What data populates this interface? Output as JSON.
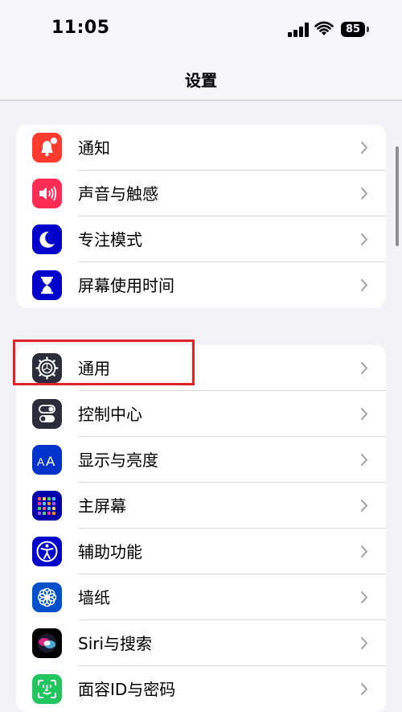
{
  "status_bar": {
    "time": "11:05",
    "battery": "85",
    "icons": [
      "signal-icon",
      "wifi-icon",
      "battery-icon"
    ]
  },
  "nav": {
    "title": "设置"
  },
  "groups": [
    {
      "items": [
        {
          "label": "通知",
          "icon": "bell-icon",
          "color": "#ff3b30"
        },
        {
          "label": "声音与触感",
          "icon": "speaker-icon",
          "color": "#ff2d55"
        },
        {
          "label": "专注模式",
          "icon": "moon-icon",
          "color": "#0000cc"
        },
        {
          "label": "屏幕使用时间",
          "icon": "hourglass-icon",
          "color": "#0000cc"
        }
      ]
    },
    {
      "items": [
        {
          "label": "通用",
          "icon": "gear-icon",
          "color": "#2c2c3a"
        },
        {
          "label": "控制中心",
          "icon": "toggles-icon",
          "color": "#2c2c3a"
        },
        {
          "label": "显示与亮度",
          "icon": "text-size-icon",
          "color": "#0033cc"
        },
        {
          "label": "主屏幕",
          "icon": "app-grid-icon",
          "color": "#0000aa"
        },
        {
          "label": "辅助功能",
          "icon": "accessibility-icon",
          "color": "#0000cc"
        },
        {
          "label": "墙纸",
          "icon": "flower-icon",
          "color": "#0050cc"
        },
        {
          "label": "Siri与搜索",
          "icon": "siri-icon",
          "color": "#000000"
        },
        {
          "label": "面容ID与密码",
          "icon": "face-id-icon",
          "color": "#22c55e"
        }
      ]
    }
  ],
  "highlight": {
    "target": "通用",
    "color": "#e0232b"
  }
}
